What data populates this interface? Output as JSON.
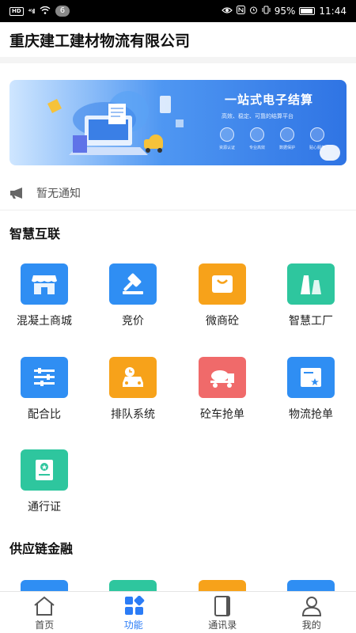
{
  "status_bar": {
    "hd": "HD",
    "signal": "⁴⁶ıll",
    "badge": "6",
    "battery_percent": "95%",
    "time": "11:44"
  },
  "header": {
    "title": "重庆建工建材物流有限公司"
  },
  "banner": {
    "title": "一站式电子结算",
    "subtitle": "高效、稳定、可靠的结算平台",
    "features": [
      {
        "label": "资源认证"
      },
      {
        "label": "专业高效"
      },
      {
        "label": "数据保护"
      },
      {
        "label": "贴心服务"
      }
    ]
  },
  "notice": {
    "text": "暂无通知"
  },
  "sections": [
    {
      "title": "智慧互联",
      "items": [
        {
          "label": "混凝土商城",
          "icon": "store-icon",
          "color": "#2f8ef3"
        },
        {
          "label": "竞价",
          "icon": "gavel-icon",
          "color": "#2f8ef3"
        },
        {
          "label": "微商砼",
          "icon": "shopping-bag-icon",
          "color": "#f7a21a"
        },
        {
          "label": "智慧工厂",
          "icon": "factory-icon",
          "color": "#2ec69e"
        },
        {
          "label": "配合比",
          "icon": "sliders-icon",
          "color": "#2f8ef3"
        },
        {
          "label": "排队系统",
          "icon": "car-clock-icon",
          "color": "#f7a21a"
        },
        {
          "label": "砼车抢单",
          "icon": "mixer-truck-icon",
          "color": "#f06a6a"
        },
        {
          "label": "物流抢单",
          "icon": "document-star-icon",
          "color": "#2f8ef3"
        },
        {
          "label": "通行证",
          "icon": "pass-card-icon",
          "color": "#2ec69e"
        }
      ]
    },
    {
      "title": "供应链金融",
      "items": [
        {
          "icon": "finance-icon-1",
          "color": "#2f8ef3"
        },
        {
          "icon": "finance-icon-2",
          "color": "#2ec69e"
        },
        {
          "icon": "finance-icon-3",
          "color": "#f7a21a"
        },
        {
          "icon": "finance-icon-4",
          "color": "#2f8ef3"
        }
      ]
    }
  ],
  "bottom_nav": [
    {
      "label": "首页",
      "icon": "home-icon",
      "active": false
    },
    {
      "label": "功能",
      "icon": "grid-icon",
      "active": true
    },
    {
      "label": "通讯录",
      "icon": "contacts-icon",
      "active": false
    },
    {
      "label": "我的",
      "icon": "user-icon",
      "active": false
    }
  ],
  "colors": {
    "accent": "#2b7cf6",
    "blue": "#2f8ef3",
    "orange": "#f7a21a",
    "green": "#2ec69e",
    "red": "#f06a6a"
  }
}
